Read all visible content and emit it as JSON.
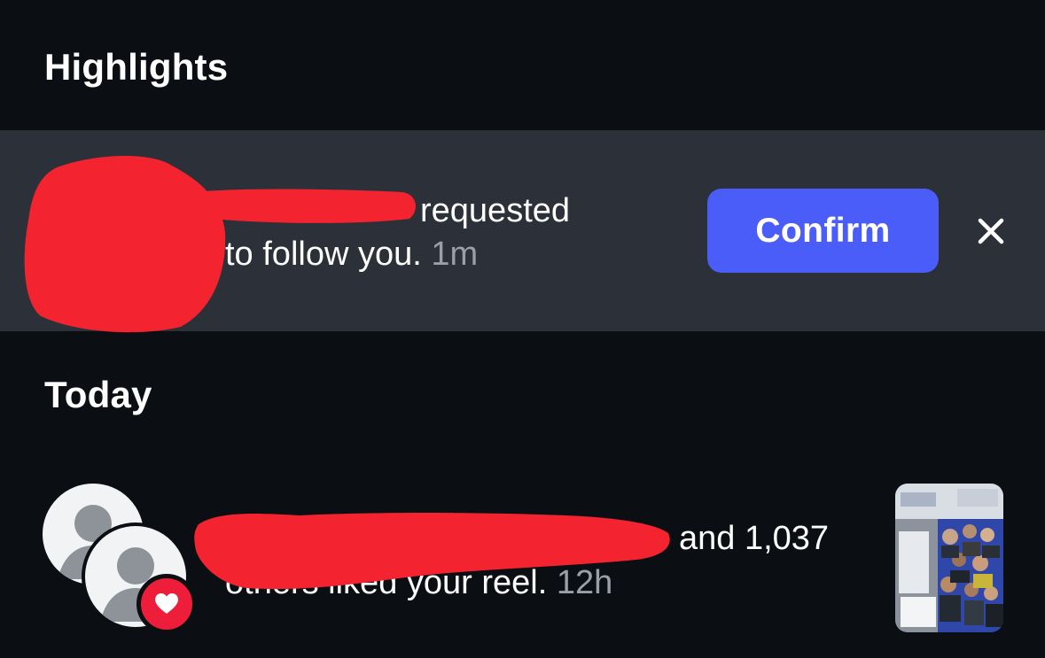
{
  "sections": {
    "highlights": "Highlights",
    "today": "Today"
  },
  "follow_request": {
    "text_line1": "requested",
    "text_line2": "to follow you.",
    "time": "1m",
    "confirm_label": "Confirm",
    "dismiss_icon": "close-icon",
    "redacted_color": "#f3232f"
  },
  "like_notification": {
    "text_line1": "and 1,037",
    "text_line2": "others liked your reel.",
    "time": "12h",
    "badge_icon": "heart-icon",
    "badge_color": "#ee1d3a"
  },
  "colors": {
    "background": "#0b0f13",
    "highlight_row": "#2c3038",
    "accent": "#4a5df9",
    "muted_text": "#9aa0a8"
  }
}
